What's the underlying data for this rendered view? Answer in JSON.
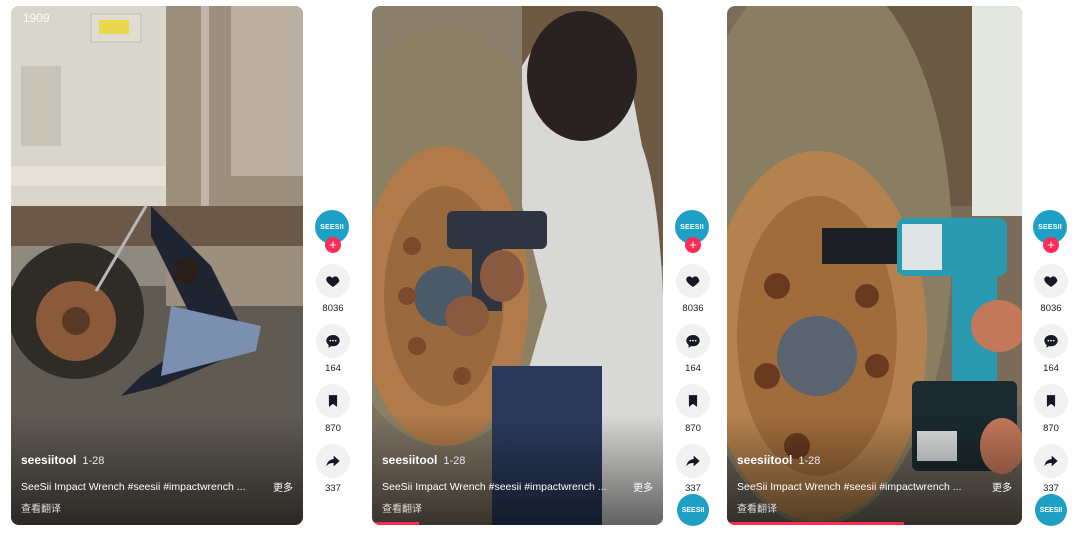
{
  "videos": [
    {
      "author": "seesiitool",
      "date": "1-28",
      "caption": "SeeSii Impact Wrench #seesii #impactwrench ...",
      "more": "更多",
      "translate": "查看翻译",
      "counter": "1909",
      "progress": 0.0
    },
    {
      "author": "seesiitool",
      "date": "1-28",
      "caption": "SeeSii Impact Wrench #seesii #impactwrench ...",
      "more": "更多",
      "translate": "查看翻译",
      "progress": 0.16
    },
    {
      "author": "seesiitool",
      "date": "1-28",
      "caption": "SeeSii Impact Wrench #seesii #impactwrench ...",
      "more": "更多",
      "translate": "查看翻译",
      "progress": 0.6
    }
  ],
  "rails": [
    {
      "avatar_text": "SEESII",
      "follow": "+",
      "likes": "8036",
      "comments": "164",
      "saves": "870",
      "shares": "337"
    },
    {
      "avatar_text": "SEESII",
      "follow": "+",
      "likes": "8036",
      "comments": "164",
      "saves": "870",
      "shares": "337"
    },
    {
      "avatar_text": "SEESII",
      "follow": "+",
      "likes": "8036",
      "comments": "164",
      "saves": "870",
      "shares": "337"
    }
  ],
  "bottom_avatars": [
    {
      "text": "SEESII"
    },
    {
      "text": "SEESII"
    }
  ],
  "colors": {
    "accent": "#fe2c55",
    "brand": "#1ea0c4",
    "action_bg": "#f1f1f2"
  },
  "icons": [
    "heart-icon",
    "comment-icon",
    "bookmark-icon",
    "share-icon",
    "plus-icon"
  ]
}
